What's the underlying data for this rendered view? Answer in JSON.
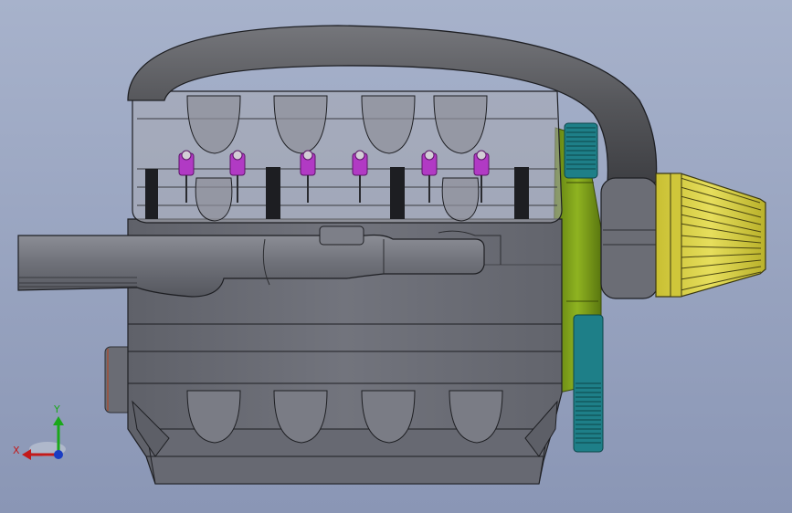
{
  "viewport": {
    "background_top": "#a3aec8",
    "background_bottom": "#8c97b6"
  },
  "model": {
    "block_color": "#6d6f78",
    "cam_cover_color": "#a5a7b0",
    "hose_color": "#5e5f63",
    "bracket_color": "#7fa01c",
    "gear_color": "#1e7f88",
    "filter_color": "#d8d04a",
    "valve_color": "#b13ac4"
  },
  "triad": {
    "y_label": "Y",
    "x_label": "X",
    "y_color": "#1aa81a",
    "x_color": "#c31a1a",
    "z_color": "#1a3cc3"
  }
}
